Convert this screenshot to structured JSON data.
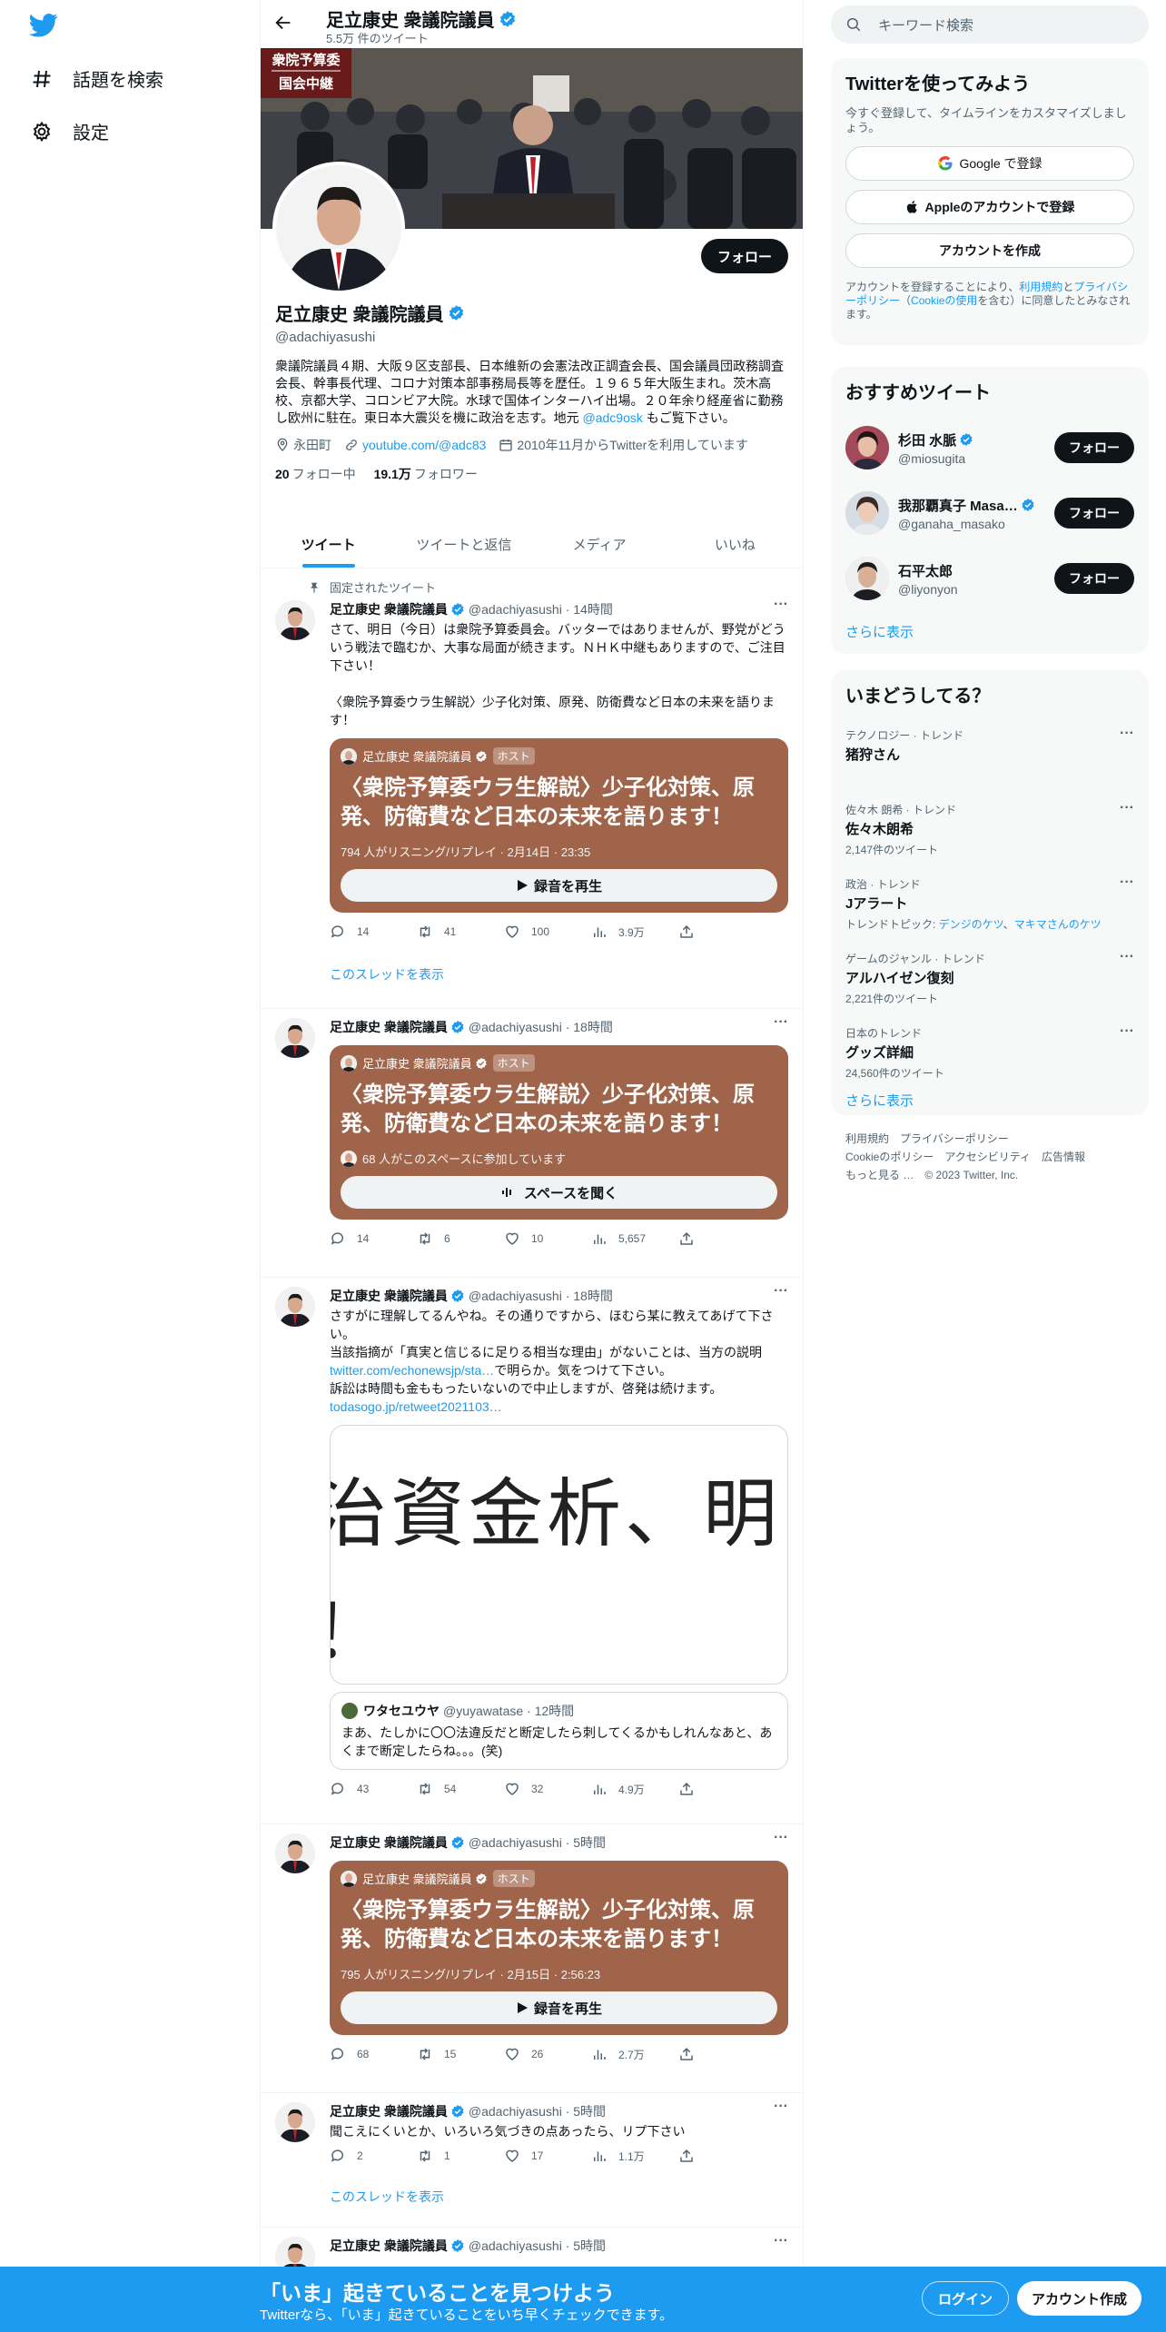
{
  "nav": {
    "logo": "twitter-bird-icon",
    "items": [
      {
        "icon": "hashtag-icon",
        "label": "話題を検索"
      },
      {
        "icon": "gear-icon",
        "label": "設定"
      }
    ]
  },
  "header": {
    "name": "足立康史 衆議院議員",
    "tweet_count": "5.5万 件のツイート"
  },
  "banner": {
    "sign_line1": "衆院予算委",
    "sign_line2": "国会中継"
  },
  "profile": {
    "name": "足立康史 衆議院議員",
    "handle": "@adachiyasushi",
    "follow_label": "フォロー",
    "bio": "衆議院議員４期、大阪９区支部長、日本維新の会憲法改正調査会長、国会議員団政務調査会長、幹事長代理、コロナ対策本部事務局長等を歴任。１９６５年大阪生まれ。茨木高校、京都大学、コロンビア大院。水球で国体インターハイ出場。２０年余り経産省に勤務し欧州に駐在。東日本大震災を機に政治を志す。地元 ",
    "bio_link": "@adc9osk",
    "bio_tail": " もご覧下さい。",
    "location": "永田町",
    "website": "youtube.com/@adc83",
    "joined": "2010年11月からTwitterを利用しています",
    "following_count": "20",
    "following_label": "フォロー中",
    "followers_count": "19.1万",
    "followers_label": "フォロワー"
  },
  "tabs": [
    "ツイート",
    "ツイートと返信",
    "メディア",
    "いいね"
  ],
  "tweets": [
    {
      "pinned": "固定されたツイート",
      "name": "足立康史 衆議院議員",
      "meta": "@adachiyasushi · 14時間",
      "text": "さて、明日（今日）は衆院予算委員会。バッターではありませんが、野党がどういう戦法で臨むか、大事な局面が続きます。ＮＨＫ中継もありますので、ご注目下さい！\n\n〈衆院予算委ウラ生解説〉少子化対策、原発、防衛費など日本の未来を語ります！",
      "card": {
        "host": "足立康史 衆議院議員",
        "badge": "ホスト",
        "title": "〈衆院予算委ウラ生解説〉少子化対策、原発、防衛費など日本の未来を語ります！",
        "meta": "794 人がリスニング/リプレイ · 2月14日 · 23:35",
        "button": "録音を再生"
      },
      "replies": "14",
      "retweets": "41",
      "likes": "100",
      "views": "3.9万",
      "thread": "このスレッドを表示"
    },
    {
      "name": "足立康史 衆議院議員",
      "meta": "@adachiyasushi · 18時間",
      "card": {
        "host": "足立康史 衆議院議員",
        "badge": "ホスト",
        "title": "〈衆院予算委ウラ生解説〉少子化対策、原発、防衛費など日本の未来を語ります！",
        "meta": "68 人がこのスペースに参加しています",
        "button": "スペースを聞く"
      },
      "replies": "14",
      "retweets": "6",
      "likes": "10",
      "views": "5,657"
    },
    {
      "name": "足立康史 衆議院議員",
      "meta": "@adachiyasushi · 18時間",
      "text1": "さすがに理解してるんやね。その通りですから、ほむら某に教えてあげて下さい。\n当該指摘が「真実と信じるに足りる相当な理由」がないことは、当方の説明",
      "link1": "twitter.com/echonewsjp/sta…",
      "text2": "で明らか。気をつけて下さい。\n訴訟は時間も金ももったいないので中止しますが、啓発は続けます。",
      "link2": "todasogo.jp/retweet2021103…",
      "media_line1": "治資金析、明ら",
      "media_line2": "！　　　　　らかして",
      "quote": {
        "name": "ワタセユウヤ",
        "meta": "@yuyawatase · 12時間",
        "text": "まあ、たしかに〇〇法違反だと断定したら刺してくるかもしれんなあと、あくまで断定したらね。。。(笑)"
      },
      "replies": "43",
      "retweets": "54",
      "likes": "32",
      "views": "4.9万"
    },
    {
      "name": "足立康史 衆議院議員",
      "meta": "@adachiyasushi · 5時間",
      "card": {
        "host": "足立康史 衆議院議員",
        "badge": "ホスト",
        "title": "〈衆院予算委ウラ生解説〉少子化対策、原発、防衛費など日本の未来を語ります！",
        "meta": "795 人がリスニング/リプレイ · 2月15日 · 2:56:23",
        "button": "録音を再生"
      },
      "replies": "68",
      "retweets": "15",
      "likes": "26",
      "views": "2.7万"
    },
    {
      "name": "足立康史 衆議院議員",
      "meta": "@adachiyasushi · 5時間",
      "text": "聞こえにくいとか、いろいろ気づきの点あったら、リプ下さい",
      "replies": "2",
      "retweets": "1",
      "likes": "17",
      "views": "1.1万",
      "thread": "このスレッドを表示"
    },
    {
      "name": "足立康史 衆議院議員",
      "meta": "@adachiyasushi · 5時間"
    }
  ],
  "search": {
    "placeholder": "キーワード検索"
  },
  "join": {
    "title": "Twitterを使ってみよう",
    "sub": "今すぐ登録して、タイムラインをカスタマイズしましょう。",
    "google": "Google で登録",
    "apple": "Appleのアカウントで登録",
    "create": "アカウントを作成",
    "legal1": "アカウントを登録することにより、",
    "legal_terms": "利用規約",
    "legal2": "と",
    "legal_privacy": "プライバシーポリシー",
    "legal3": "（",
    "legal_cookie": "Cookieの使用",
    "legal4": "を含む）に同意したとみなされます。"
  },
  "recommended": {
    "title": "おすすめツイート",
    "users": [
      {
        "name": "杉田 水脈",
        "handle": "@miosugita",
        "verified": true,
        "button": "フォロー"
      },
      {
        "name": "我那覇真子 Masa…",
        "handle": "@ganaha_masako",
        "verified": true,
        "button": "フォロー"
      },
      {
        "name": "石平太郎",
        "handle": "@liyonyon",
        "verified": false,
        "button": "フォロー"
      }
    ],
    "more": "さらに表示"
  },
  "trends": {
    "title": "いまどうしてる？",
    "items": [
      {
        "context": "テクノロジー · トレンド",
        "name": "猪狩さん",
        "posts": ""
      },
      {
        "context": "佐々木 朗希 · トレンド",
        "name": "佐々木朗希",
        "posts": "2,147件のツイート"
      },
      {
        "context": "政治 · トレンド",
        "name": "Jアラート",
        "posts": "トレンドトピック: ",
        "topic1": "デンジのケツ",
        "topic_sep": "、",
        "topic2": "マキマさんのケツ"
      },
      {
        "context": "ゲームのジャンル · トレンド",
        "name": "アルハイゼン復刻",
        "posts": "2,221件のツイート"
      },
      {
        "context": "日本のトレンド",
        "name": "グッズ詳細",
        "posts": "24,560件のツイート"
      }
    ],
    "more": "さらに表示"
  },
  "footer": {
    "links": [
      "利用規約",
      "プライバシーポリシー",
      "Cookieのポリシー",
      "アクセシビリティ",
      "広告情報",
      "もっと見る …",
      "© 2023 Twitter, Inc."
    ]
  },
  "bottom": {
    "title": "「いま」起きていることを見つけよう",
    "sub": "Twitterなら、「いま」起きていることをいち早くチェックできます。",
    "login": "ログイン",
    "signup": "アカウント作成"
  },
  "colors": {
    "accent": "#1d9bf0",
    "space_card": "#a0644a",
    "text": "#0f1419",
    "muted": "#536471"
  }
}
